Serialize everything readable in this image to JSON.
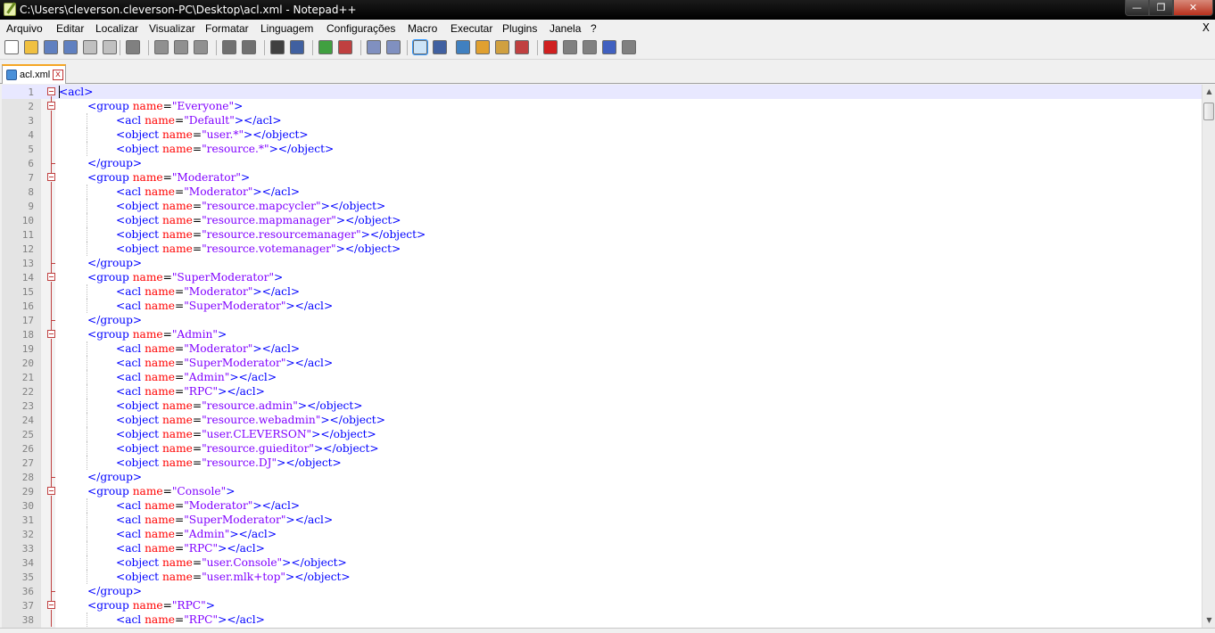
{
  "window": {
    "title": "C:\\Users\\cleverson.cleverson-PC\\Desktop\\acl.xml - Notepad++",
    "minimize_icon": "minimize-icon",
    "maximize_icon": "maximize-icon",
    "close_icon": "close-icon",
    "min_glyph": "—",
    "max_glyph": "❐",
    "close_glyph": "✕"
  },
  "menu": {
    "items": [
      "Arquivo",
      "Editar",
      "Localizar",
      "Visualizar",
      "Formatar",
      "Linguagem",
      "Configurações",
      "Macro",
      "Executar",
      "Plugins",
      "Janela",
      "?"
    ],
    "close_label": "X"
  },
  "toolbar": {
    "icons": [
      "new-file-icon",
      "open-file-icon",
      "save-icon",
      "save-all-icon",
      "close-icon",
      "close-all-icon",
      "print-icon",
      "cut-icon",
      "copy-icon",
      "paste-icon",
      "undo-icon",
      "redo-icon",
      "find-icon",
      "replace-icon",
      "zoom-in-icon",
      "zoom-out-icon",
      "sync-vertical-icon",
      "sync-horizontal-icon",
      "word-wrap-icon",
      "show-all-chars-icon",
      "indent-guide-icon",
      "user-lang-icon",
      "doc-map-icon",
      "function-list-icon",
      "record-macro-icon",
      "stop-macro-icon",
      "play-macro-icon",
      "run-macro-multiple-icon",
      "save-macro-icon"
    ]
  },
  "tab": {
    "label": "acl.xml",
    "icon": "file-icon",
    "close_glyph": "x"
  },
  "colors": {
    "tag": "#0000ff",
    "attribute": "#ff0000",
    "value": "#8000ff",
    "current_line": "#e8e8ff"
  },
  "editor": {
    "current_line": 1,
    "lines": [
      {
        "n": "1",
        "indent": 0,
        "tokens": [
          [
            "tag",
            "<acl>"
          ]
        ],
        "fold": "open"
      },
      {
        "n": "2",
        "indent": 1,
        "tokens": [
          [
            "tag",
            "<group "
          ],
          [
            "attr",
            "name"
          ],
          [
            "eq",
            "="
          ],
          [
            "val",
            "\"Everyone\""
          ],
          [
            "tag",
            ">"
          ]
        ],
        "fold": "open"
      },
      {
        "n": "3",
        "indent": 2,
        "tokens": [
          [
            "tag",
            "<acl "
          ],
          [
            "attr",
            "name"
          ],
          [
            "eq",
            "="
          ],
          [
            "val",
            "\"Default\""
          ],
          [
            "tag",
            "></acl>"
          ]
        ]
      },
      {
        "n": "4",
        "indent": 2,
        "tokens": [
          [
            "tag",
            "<object "
          ],
          [
            "attr",
            "name"
          ],
          [
            "eq",
            "="
          ],
          [
            "val",
            "\"user.*\""
          ],
          [
            "tag",
            "></object>"
          ]
        ]
      },
      {
        "n": "5",
        "indent": 2,
        "tokens": [
          [
            "tag",
            "<object "
          ],
          [
            "attr",
            "name"
          ],
          [
            "eq",
            "="
          ],
          [
            "val",
            "\"resource.*\""
          ],
          [
            "tag",
            "></object>"
          ]
        ]
      },
      {
        "n": "6",
        "indent": 1,
        "tokens": [
          [
            "tag",
            "</group>"
          ]
        ],
        "fold": "end"
      },
      {
        "n": "7",
        "indent": 1,
        "tokens": [
          [
            "tag",
            "<group "
          ],
          [
            "attr",
            "name"
          ],
          [
            "eq",
            "="
          ],
          [
            "val",
            "\"Moderator\""
          ],
          [
            "tag",
            ">"
          ]
        ],
        "fold": "open"
      },
      {
        "n": "8",
        "indent": 2,
        "tokens": [
          [
            "tag",
            "<acl "
          ],
          [
            "attr",
            "name"
          ],
          [
            "eq",
            "="
          ],
          [
            "val",
            "\"Moderator\""
          ],
          [
            "tag",
            "></acl>"
          ]
        ]
      },
      {
        "n": "9",
        "indent": 2,
        "tokens": [
          [
            "tag",
            "<object "
          ],
          [
            "attr",
            "name"
          ],
          [
            "eq",
            "="
          ],
          [
            "val",
            "\"resource.mapcycler\""
          ],
          [
            "tag",
            "></object>"
          ]
        ]
      },
      {
        "n": "10",
        "indent": 2,
        "tokens": [
          [
            "tag",
            "<object "
          ],
          [
            "attr",
            "name"
          ],
          [
            "eq",
            "="
          ],
          [
            "val",
            "\"resource.mapmanager\""
          ],
          [
            "tag",
            "></object>"
          ]
        ]
      },
      {
        "n": "11",
        "indent": 2,
        "tokens": [
          [
            "tag",
            "<object "
          ],
          [
            "attr",
            "name"
          ],
          [
            "eq",
            "="
          ],
          [
            "val",
            "\"resource.resourcemanager\""
          ],
          [
            "tag",
            "></object>"
          ]
        ]
      },
      {
        "n": "12",
        "indent": 2,
        "tokens": [
          [
            "tag",
            "<object "
          ],
          [
            "attr",
            "name"
          ],
          [
            "eq",
            "="
          ],
          [
            "val",
            "\"resource.votemanager\""
          ],
          [
            "tag",
            "></object>"
          ]
        ]
      },
      {
        "n": "13",
        "indent": 1,
        "tokens": [
          [
            "tag",
            "</group>"
          ]
        ],
        "fold": "end"
      },
      {
        "n": "14",
        "indent": 1,
        "tokens": [
          [
            "tag",
            "<group "
          ],
          [
            "attr",
            "name"
          ],
          [
            "eq",
            "="
          ],
          [
            "val",
            "\"SuperModerator\""
          ],
          [
            "tag",
            ">"
          ]
        ],
        "fold": "open"
      },
      {
        "n": "15",
        "indent": 2,
        "tokens": [
          [
            "tag",
            "<acl "
          ],
          [
            "attr",
            "name"
          ],
          [
            "eq",
            "="
          ],
          [
            "val",
            "\"Moderator\""
          ],
          [
            "tag",
            "></acl>"
          ]
        ]
      },
      {
        "n": "16",
        "indent": 2,
        "tokens": [
          [
            "tag",
            "<acl "
          ],
          [
            "attr",
            "name"
          ],
          [
            "eq",
            "="
          ],
          [
            "val",
            "\"SuperModerator\""
          ],
          [
            "tag",
            "></acl>"
          ]
        ]
      },
      {
        "n": "17",
        "indent": 1,
        "tokens": [
          [
            "tag",
            "</group>"
          ]
        ],
        "fold": "end"
      },
      {
        "n": "18",
        "indent": 1,
        "tokens": [
          [
            "tag",
            "<group "
          ],
          [
            "attr",
            "name"
          ],
          [
            "eq",
            "="
          ],
          [
            "val",
            "\"Admin\""
          ],
          [
            "tag",
            ">"
          ]
        ],
        "fold": "open"
      },
      {
        "n": "19",
        "indent": 2,
        "tokens": [
          [
            "tag",
            "<acl "
          ],
          [
            "attr",
            "name"
          ],
          [
            "eq",
            "="
          ],
          [
            "val",
            "\"Moderator\""
          ],
          [
            "tag",
            "></acl>"
          ]
        ]
      },
      {
        "n": "20",
        "indent": 2,
        "tokens": [
          [
            "tag",
            "<acl "
          ],
          [
            "attr",
            "name"
          ],
          [
            "eq",
            "="
          ],
          [
            "val",
            "\"SuperModerator\""
          ],
          [
            "tag",
            "></acl>"
          ]
        ]
      },
      {
        "n": "21",
        "indent": 2,
        "tokens": [
          [
            "tag",
            "<acl "
          ],
          [
            "attr",
            "name"
          ],
          [
            "eq",
            "="
          ],
          [
            "val",
            "\"Admin\""
          ],
          [
            "tag",
            "></acl>"
          ]
        ]
      },
      {
        "n": "22",
        "indent": 2,
        "tokens": [
          [
            "tag",
            "<acl "
          ],
          [
            "attr",
            "name"
          ],
          [
            "eq",
            "="
          ],
          [
            "val",
            "\"RPC\""
          ],
          [
            "tag",
            "></acl>"
          ]
        ]
      },
      {
        "n": "23",
        "indent": 2,
        "tokens": [
          [
            "tag",
            "<object "
          ],
          [
            "attr",
            "name"
          ],
          [
            "eq",
            "="
          ],
          [
            "val",
            "\"resource.admin\""
          ],
          [
            "tag",
            "></object>"
          ]
        ]
      },
      {
        "n": "24",
        "indent": 2,
        "tokens": [
          [
            "tag",
            "<object "
          ],
          [
            "attr",
            "name"
          ],
          [
            "eq",
            "="
          ],
          [
            "val",
            "\"resource.webadmin\""
          ],
          [
            "tag",
            "></object>"
          ]
        ]
      },
      {
        "n": "25",
        "indent": 2,
        "tokens": [
          [
            "tag",
            "<object "
          ],
          [
            "attr",
            "name"
          ],
          [
            "eq",
            "="
          ],
          [
            "val",
            "\"user.CLEVERSON\""
          ],
          [
            "tag",
            "></object>"
          ]
        ]
      },
      {
        "n": "26",
        "indent": 2,
        "tokens": [
          [
            "tag",
            "<object "
          ],
          [
            "attr",
            "name"
          ],
          [
            "eq",
            "="
          ],
          [
            "val",
            "\"resource.guieditor\""
          ],
          [
            "tag",
            "></object>"
          ]
        ]
      },
      {
        "n": "27",
        "indent": 2,
        "tokens": [
          [
            "tag",
            "<object "
          ],
          [
            "attr",
            "name"
          ],
          [
            "eq",
            "="
          ],
          [
            "val",
            "\"resource.DJ\""
          ],
          [
            "tag",
            "></object>"
          ]
        ]
      },
      {
        "n": "28",
        "indent": 1,
        "tokens": [
          [
            "tag",
            "</group>"
          ]
        ],
        "fold": "end"
      },
      {
        "n": "29",
        "indent": 1,
        "tokens": [
          [
            "tag",
            "<group "
          ],
          [
            "attr",
            "name"
          ],
          [
            "eq",
            "="
          ],
          [
            "val",
            "\"Console\""
          ],
          [
            "tag",
            ">"
          ]
        ],
        "fold": "open"
      },
      {
        "n": "30",
        "indent": 2,
        "tokens": [
          [
            "tag",
            "<acl "
          ],
          [
            "attr",
            "name"
          ],
          [
            "eq",
            "="
          ],
          [
            "val",
            "\"Moderator\""
          ],
          [
            "tag",
            "></acl>"
          ]
        ]
      },
      {
        "n": "31",
        "indent": 2,
        "tokens": [
          [
            "tag",
            "<acl "
          ],
          [
            "attr",
            "name"
          ],
          [
            "eq",
            "="
          ],
          [
            "val",
            "\"SuperModerator\""
          ],
          [
            "tag",
            "></acl>"
          ]
        ]
      },
      {
        "n": "32",
        "indent": 2,
        "tokens": [
          [
            "tag",
            "<acl "
          ],
          [
            "attr",
            "name"
          ],
          [
            "eq",
            "="
          ],
          [
            "val",
            "\"Admin\""
          ],
          [
            "tag",
            "></acl>"
          ]
        ]
      },
      {
        "n": "33",
        "indent": 2,
        "tokens": [
          [
            "tag",
            "<acl "
          ],
          [
            "attr",
            "name"
          ],
          [
            "eq",
            "="
          ],
          [
            "val",
            "\"RPC\""
          ],
          [
            "tag",
            "></acl>"
          ]
        ]
      },
      {
        "n": "34",
        "indent": 2,
        "tokens": [
          [
            "tag",
            "<object "
          ],
          [
            "attr",
            "name"
          ],
          [
            "eq",
            "="
          ],
          [
            "val",
            "\"user.Console\""
          ],
          [
            "tag",
            "></object>"
          ]
        ]
      },
      {
        "n": "35",
        "indent": 2,
        "tokens": [
          [
            "tag",
            "<object "
          ],
          [
            "attr",
            "name"
          ],
          [
            "eq",
            "="
          ],
          [
            "val",
            "\"user.mlk+top\""
          ],
          [
            "tag",
            "></object>"
          ]
        ]
      },
      {
        "n": "36",
        "indent": 1,
        "tokens": [
          [
            "tag",
            "</group>"
          ]
        ],
        "fold": "end"
      },
      {
        "n": "37",
        "indent": 1,
        "tokens": [
          [
            "tag",
            "<group "
          ],
          [
            "attr",
            "name"
          ],
          [
            "eq",
            "="
          ],
          [
            "val",
            "\"RPC\""
          ],
          [
            "tag",
            ">"
          ]
        ],
        "fold": "open"
      },
      {
        "n": "38",
        "indent": 2,
        "tokens": [
          [
            "tag",
            "<acl "
          ],
          [
            "attr",
            "name"
          ],
          [
            "eq",
            "="
          ],
          [
            "val",
            "\"RPC\""
          ],
          [
            "tag",
            "></acl>"
          ]
        ]
      }
    ]
  },
  "scrollbar": {
    "up_icon": "scroll-up-icon",
    "down_icon": "scroll-down-icon",
    "up_glyph": "▲",
    "down_glyph": "▼"
  }
}
